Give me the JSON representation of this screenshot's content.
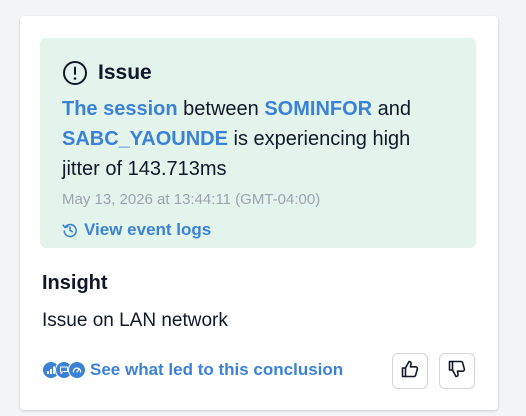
{
  "issue": {
    "title": "Issue",
    "session_link": "The session",
    "between": " between ",
    "source": "SOMINFOR",
    "and": " and ",
    "destination": "SABC_YAOUNDE",
    "rest": " is experiencing high jitter of 143.713ms",
    "timestamp": "May 13, 2026 at 13:44:11 (GMT-04:00)",
    "event_logs_label": "View event logs"
  },
  "insight": {
    "title": "Insight",
    "text": "Issue on LAN network"
  },
  "conclusion_link_label": "See what led to this conclusion",
  "icons": {
    "issue": "exclamation-circle-icon",
    "event_logs": "history-icon",
    "badges": [
      "analytics-icon",
      "chat-icon",
      "gauge-icon"
    ],
    "feedback_up": "thumbs-up-icon",
    "feedback_down": "thumbs-down-icon"
  },
  "colors": {
    "accent": "#3b82d6",
    "issue_background": "#e3f4ec",
    "muted_text": "#9ca3af"
  }
}
